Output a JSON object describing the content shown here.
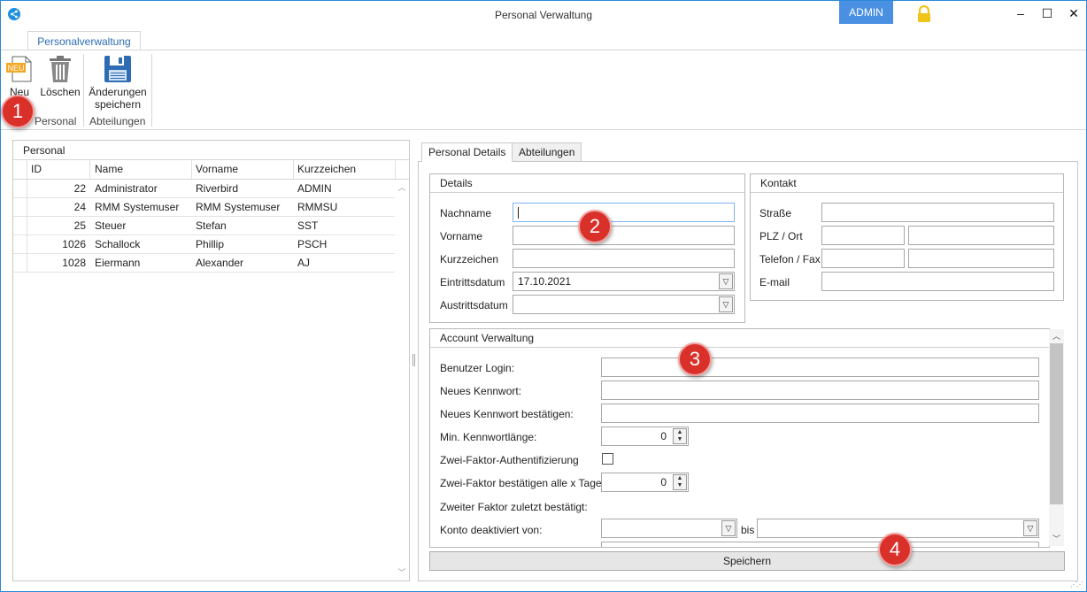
{
  "window": {
    "title": "Personal Verwaltung",
    "user": "ADMIN",
    "minimize": "–",
    "maximize": "☐",
    "close": "✕",
    "accent": "#2b88d8"
  },
  "ribbon": {
    "tab": "Personalverwaltung",
    "new_label": "Neu",
    "new_badge": "NEU",
    "delete_label": "Löschen",
    "save_changes_line1": "Änderungen",
    "save_changes_line2": "speichern",
    "group_personal": "Personal",
    "group_departments": "Abteilungen"
  },
  "markers": [
    "1",
    "2",
    "3",
    "4"
  ],
  "grid": {
    "title": "Personal",
    "columns": [
      "ID",
      "Name",
      "Vorname",
      "Kurzzeichen"
    ],
    "rows": [
      {
        "id": "22",
        "name": "Administrator",
        "first": "Riverbird",
        "short": "ADMIN"
      },
      {
        "id": "24",
        "name": "RMM Systemuser",
        "first": "RMM Systemuser",
        "short": "RMMSU"
      },
      {
        "id": "25",
        "name": "Steuer",
        "first": "Stefan",
        "short": "SST"
      },
      {
        "id": "1026",
        "name": "Schallock",
        "first": "Phillip",
        "short": "PSCH"
      },
      {
        "id": "1028",
        "name": "Eiermann",
        "first": "Alexander",
        "short": "AJ"
      }
    ]
  },
  "tabs": {
    "details": "Personal Details",
    "departments": "Abteilungen"
  },
  "details": {
    "header": "Details",
    "lastname": "Nachname",
    "firstname": "Vorname",
    "initials": "Kurzzeichen",
    "entry_date": "Eintrittsdatum",
    "entry_date_value": "17.10.2021",
    "exit_date": "Austrittsdatum"
  },
  "contact": {
    "header": "Kontakt",
    "street": "Straße",
    "zip_city": "PLZ / Ort",
    "phone_fax": "Telefon / Fax",
    "email": "E-mail"
  },
  "account": {
    "header": "Account Verwaltung",
    "login": "Benutzer Login:",
    "new_password": "Neues Kennwort:",
    "confirm_password": "Neues Kennwort bestätigen:",
    "min_length": "Min. Kennwortlänge:",
    "min_length_value": "0",
    "two_factor": "Zwei-Faktor-Authentifizierung",
    "two_factor_days": "Zwei-Faktor bestätigen alle x Tage",
    "two_factor_days_value": "0",
    "last_confirmed": "Zweiter Faktor zuletzt bestätigt:",
    "deactivated_from": "Konto deaktiviert von:",
    "until": "bis"
  },
  "save_button": "Speichern"
}
